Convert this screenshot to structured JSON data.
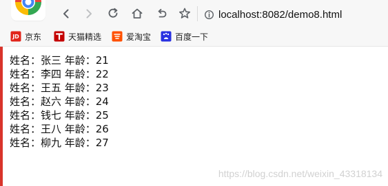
{
  "browser": {
    "url": "localhost:8082/demo8.html"
  },
  "bookmarks": [
    {
      "label": "京东",
      "icon": "jd-icon",
      "color": "#e1251b"
    },
    {
      "label": "天猫精选",
      "icon": "tmall-icon",
      "color": "#c40000"
    },
    {
      "label": "爱淘宝",
      "icon": "taobao-icon",
      "color": "#ff5000"
    },
    {
      "label": "百度一下",
      "icon": "baidu-icon",
      "color": "#2932e1"
    }
  ],
  "content": {
    "lines": [
      "姓名：张三 年龄：21",
      "姓名：李四 年龄：22",
      "姓名：王五 年龄：23",
      "姓名：赵六 年龄：24",
      "姓名：钱七 年龄：25",
      "姓名：王八 年龄：26",
      "姓名：柳九 年龄：27"
    ]
  },
  "watermark": "https://blog.csdn.net/weixin_43318134"
}
